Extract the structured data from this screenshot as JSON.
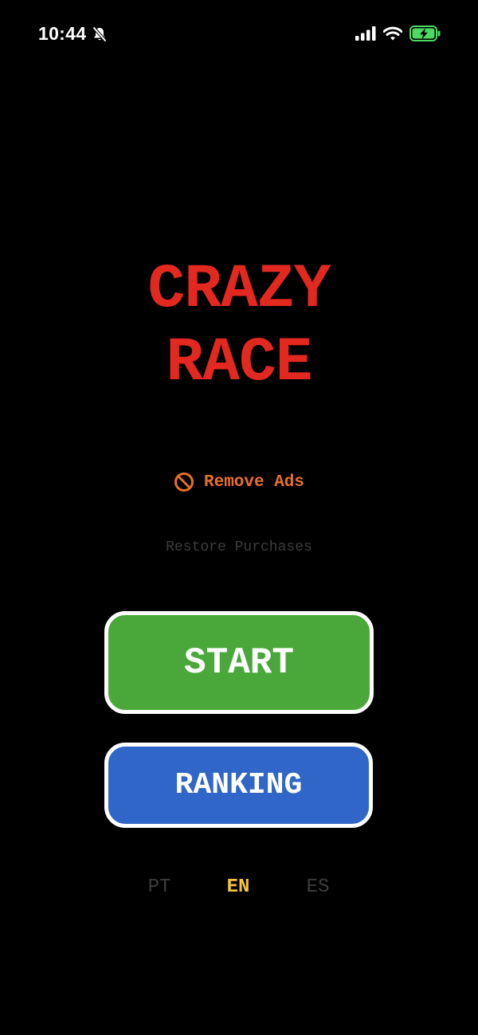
{
  "status_bar": {
    "time": "10:44",
    "icons": [
      "bell-slash-icon",
      "signal-icon",
      "wifi-icon",
      "battery-charging-icon"
    ],
    "battery_color": "#4cd964"
  },
  "title": {
    "line1": "CRAZY",
    "line2": "RACE",
    "color": "#e3291f"
  },
  "remove_ads": {
    "label": "Remove Ads",
    "icon": "no-ads-icon",
    "color": "#e8702a"
  },
  "restore_purchases": {
    "label": "Restore Purchases"
  },
  "buttons": {
    "start": {
      "label": "START",
      "color": "#4aa83a"
    },
    "ranking": {
      "label": "RANKING",
      "color": "#2f66c7"
    }
  },
  "languages": {
    "items": [
      "PT",
      "EN",
      "ES"
    ],
    "selected": "EN",
    "selected_color": "#f2c53b"
  }
}
